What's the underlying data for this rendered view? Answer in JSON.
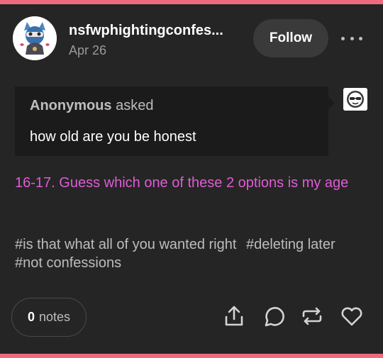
{
  "accent_bar_color": "#f06a7e",
  "post": {
    "blog_name": "nsfwphightingconfes...",
    "date": "Apr 26",
    "follow_label": "Follow",
    "ask": {
      "asker": "Anonymous",
      "asked_label": " asked",
      "question": "how old are you be honest"
    },
    "answer": "16-17. Guess which one of these 2 options is my age",
    "answer_color": "#e05bd6",
    "tags": [
      "#is that what all of you wanted right",
      "#deleting later",
      "#not confessions"
    ],
    "notes_count": "0",
    "notes_label": "notes",
    "actions": [
      "share-icon",
      "reply-icon",
      "reblog-icon",
      "like-icon"
    ]
  }
}
